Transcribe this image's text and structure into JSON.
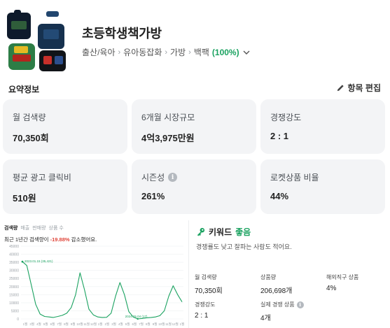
{
  "product": {
    "title": "초등학생책가방",
    "breadcrumb": [
      "출산/육아",
      "유아동잡화",
      "가방",
      "백팩"
    ],
    "match_pct": "(100%)"
  },
  "summary": {
    "title": "요약정보",
    "edit_label": "항목 편집"
  },
  "cards": [
    {
      "label": "월 검색량",
      "value": "70,350회"
    },
    {
      "label": "6개월 시장규모",
      "value": "4억3,975만원"
    },
    {
      "label": "경쟁강도",
      "value": "2 : 1"
    },
    {
      "label": "평균 광고 클릭비",
      "value": "510원"
    },
    {
      "label": "시즌성",
      "value": "261%"
    },
    {
      "label": "로켓상품 비율",
      "value": "44%"
    }
  ],
  "chart_tabs": [
    "검색량",
    "매출",
    "판매량",
    "상품 수"
  ],
  "chart_desc": {
    "pre": "최근 1년간 검색량이 ",
    "neg": "-19.88%",
    "post": " 감소했어요."
  },
  "chart_data": {
    "type": "line",
    "x_ticks": [
      "1월",
      "3월",
      "4월",
      "5월",
      "6월",
      "7월",
      "8월",
      "9월",
      "10월",
      "11월",
      "12월",
      "1월",
      "2월",
      "3월",
      "4월",
      "5월",
      "6월",
      "7월",
      "8월",
      "9월",
      "10월",
      "11월",
      "12월",
      "1월"
    ],
    "y_ticks": [
      "0",
      "5000",
      "10000",
      "15000",
      "20000",
      "25000",
      "30000",
      "35000",
      "40000",
      "45000"
    ],
    "ylim": [
      0,
      45000
    ],
    "annotations": [
      {
        "text": "2023.01.15 (35,421)"
      },
      {
        "text": "2024.05.04 (17)"
      }
    ],
    "series": [
      {
        "color": "#1aa260",
        "values": [
          35400,
          33000,
          21000,
          9000,
          3000,
          1500,
          1200,
          900,
          1500,
          2200,
          3500,
          7000,
          15000,
          28500,
          18000,
          6000,
          2500,
          1200,
          900,
          1000,
          3500,
          14000,
          22500,
          15000,
          4500,
          1200,
          17,
          300,
          700,
          900,
          1200,
          2000,
          5000,
          14000,
          20500,
          15000,
          10500
        ]
      }
    ]
  },
  "keyword": {
    "title": "키워드",
    "grade": "좋음",
    "desc": "경쟁률도 낮고 잘파는 사람도 적어요."
  },
  "stats": [
    {
      "label": "월 검색량",
      "value": "70,350회"
    },
    {
      "label": "상품량",
      "value": "206,698개"
    },
    {
      "label": "해외직구 상품",
      "value": "4%"
    },
    {
      "label": "경쟁강도",
      "value": "2 : 1"
    },
    {
      "label": "실제 경쟁 상품",
      "value": "4개"
    }
  ],
  "colors": {
    "accent": "#1aa260",
    "negative": "#e0453a",
    "card_bg": "#f3f4f6"
  }
}
